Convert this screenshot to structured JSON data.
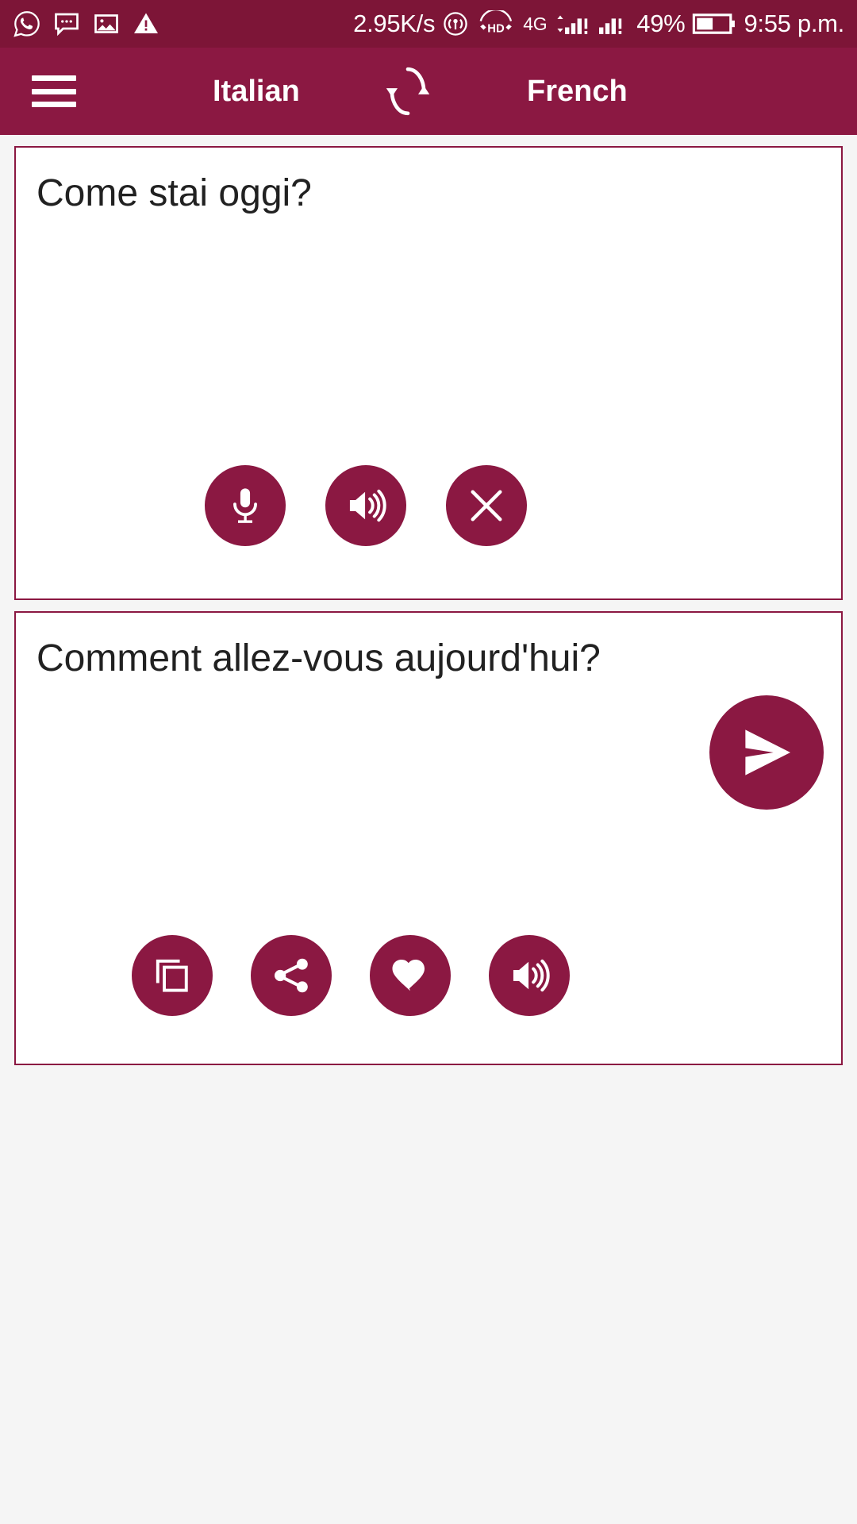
{
  "status_bar": {
    "background": "#7d1537",
    "notifications": [
      {
        "name": "whatsapp-icon",
        "label": "WhatsApp"
      },
      {
        "name": "message-icon",
        "label": "Message"
      },
      {
        "name": "image-icon",
        "label": "Image"
      },
      {
        "name": "warning-icon",
        "label": "Warning"
      }
    ],
    "network_speed": "2.95K/s",
    "hotspot_icon": "hotspot-icon",
    "hd_label": "HD",
    "network_type": "4G",
    "signal_1_label": "1",
    "signal_2_label": "2",
    "battery_percent": "49%",
    "time": "9:55 p.m."
  },
  "app_bar": {
    "background": "#8b1842",
    "menu_icon": "hamburger-menu-icon",
    "source_language": "Italian",
    "swap_icon": "swap-languages-icon",
    "target_language": "French"
  },
  "input_card": {
    "text_parts": [
      {
        "text": "Come ",
        "misspelled": false
      },
      {
        "text": "stai",
        "misspelled": true
      },
      {
        "text": " ",
        "misspelled": false
      },
      {
        "text": "oggi",
        "misspelled": true
      },
      {
        "text": "?",
        "misspelled": false
      }
    ],
    "full_text": "Come stai oggi?",
    "spellcheck_color": "#e8544f",
    "buttons": [
      {
        "name": "microphone-button",
        "label": "Voice input"
      },
      {
        "name": "speak-source-button",
        "label": "Speak source text"
      },
      {
        "name": "clear-text-button",
        "label": "Clear text"
      }
    ]
  },
  "send_button": {
    "name": "translate-send-button",
    "label": "Translate"
  },
  "output_card": {
    "full_text": "Comment allez-vous aujourd'hui?",
    "buttons": [
      {
        "name": "copy-button",
        "label": "Copy translation"
      },
      {
        "name": "share-button",
        "label": "Share translation"
      },
      {
        "name": "favorite-button",
        "label": "Add to favorites"
      },
      {
        "name": "speak-translation-button",
        "label": "Speak translation"
      }
    ]
  },
  "theme": {
    "primary": "#8b1842",
    "status_bar": "#7d1537",
    "page_background": "#f5f5f5",
    "card_background": "#ffffff",
    "text": "#212121"
  }
}
